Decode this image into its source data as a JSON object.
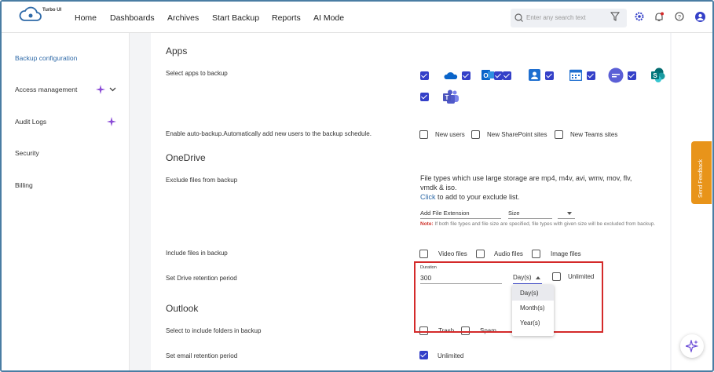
{
  "brand": {
    "name": "Turbo UI"
  },
  "nav": {
    "items": [
      "Home",
      "Dashboards",
      "Archives",
      "Start Backup",
      "Reports",
      "AI Mode"
    ]
  },
  "search": {
    "placeholder": "Enter any search text"
  },
  "sidebar": {
    "items": [
      "Backup configuration",
      "Access management",
      "Audit Logs",
      "Security",
      "Billing"
    ],
    "active": "Backup configuration"
  },
  "sections": {
    "apps": "Apps",
    "onedrive": "OneDrive",
    "outlook": "Outlook"
  },
  "rows": {
    "select_apps": "Select apps to backup",
    "auto_backup": "Enable auto-backup.Automatically add new users to the backup schedule.",
    "exclude_files": "Exclude files from backup",
    "include_files": "Include files in backup",
    "drive_retention": "Set Drive retention period",
    "include_folders": "Select to include folders in backup",
    "email_retention": "Set email retention period"
  },
  "apps": [
    "onedrive-icon",
    "outlook-icon",
    "contacts-icon",
    "calendar-icon",
    "chat-icon",
    "sharepoint-icon",
    "teams-icon"
  ],
  "auto_backup": {
    "options": [
      "New users",
      "New SharePoint sites",
      "New Teams sites"
    ]
  },
  "exclude": {
    "info_line1": "File types which use large storage are mp4, m4v, avi, wmv, mov, flv,",
    "info_line2": "vmdk & iso.",
    "click": "Click",
    "info_line3": " to add to your exclude list.",
    "add_ext_label": "Add File Extension",
    "size_label": "Size",
    "note_label": "Note:",
    "note_text": " If both file types and file size are specified, file types with given size will be excluded from backup."
  },
  "include": {
    "options": [
      "Video files",
      "Audio files",
      "Image files"
    ]
  },
  "retention": {
    "duration_label": "Duration",
    "duration_value": "300",
    "unit_selected": "Day(s)",
    "unlimited": "Unlimited",
    "unit_options": [
      "Day(s)",
      "Month(s)",
      "Year(s)"
    ]
  },
  "folders": {
    "options": [
      "Trash",
      "Spam"
    ]
  },
  "email_retention": {
    "unlimited": "Unlimited",
    "checked": true
  },
  "feedback": {
    "label": "Send Feedback"
  },
  "colors": {
    "accent": "#3440c8",
    "link": "#2f6aa8",
    "highlight": "#d42a2a",
    "feedback": "#e8941a"
  }
}
